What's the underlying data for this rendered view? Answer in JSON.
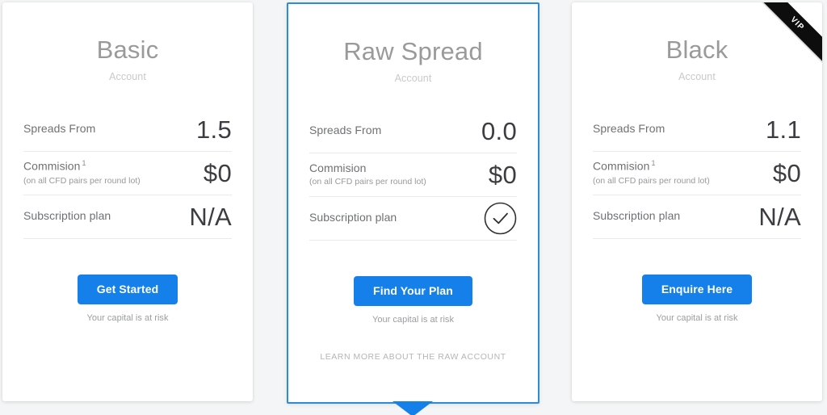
{
  "page": {
    "background_color": "#f4f5f6",
    "accent_color": "#1680ea",
    "highlight_border_color": "#2e8bd8",
    "ribbon_color": "#0d0d0d"
  },
  "row_labels": {
    "spreads": "Spreads From",
    "commission": "Commision",
    "commission_footnote_marker": "1",
    "commission_note": "(on all CFD pairs per round lot)",
    "subscription": "Subscription plan"
  },
  "cards": [
    {
      "id": "basic",
      "title": "Basic",
      "subtitle": "Account",
      "featured": false,
      "ribbon": null,
      "has_commission_footnote": true,
      "spreads_value": "1.5",
      "commission_value": "$0",
      "subscription_value": "N/A",
      "subscription_is_check": false,
      "cta_label": "Get Started",
      "risk_note": "Your capital is at risk",
      "learn_more_label": null
    },
    {
      "id": "raw-spread",
      "title": "Raw Spread",
      "subtitle": "Account",
      "featured": true,
      "ribbon": null,
      "has_commission_footnote": false,
      "spreads_value": "0.0",
      "commission_value": "$0",
      "subscription_value": "check-circle-icon",
      "subscription_is_check": true,
      "cta_label": "Find Your Plan",
      "risk_note": "Your capital is at risk",
      "learn_more_label": "LEARN MORE ABOUT THE RAW ACCOUNT"
    },
    {
      "id": "black",
      "title": "Black",
      "subtitle": "Account",
      "featured": false,
      "ribbon": "VIP",
      "has_commission_footnote": true,
      "spreads_value": "1.1",
      "commission_value": "$0",
      "subscription_value": "N/A",
      "subscription_is_check": false,
      "cta_label": "Enquire Here",
      "risk_note": "Your capital is at risk",
      "learn_more_label": null
    }
  ]
}
